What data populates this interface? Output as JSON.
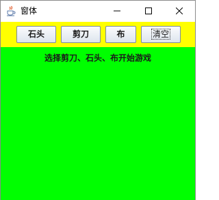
{
  "window": {
    "title": "窗体",
    "app_icon": "java-coffee-icon",
    "controls": [
      "minimize-icon",
      "maximize-icon",
      "close-icon"
    ]
  },
  "toolbar": {
    "background": "#ffff00",
    "buttons": [
      {
        "label": "石头"
      },
      {
        "label": "剪刀"
      },
      {
        "label": "布"
      },
      {
        "label": "清空"
      }
    ]
  },
  "content": {
    "background": "#00ff00",
    "status_text": "选择剪刀、石头、布开始游戏"
  }
}
